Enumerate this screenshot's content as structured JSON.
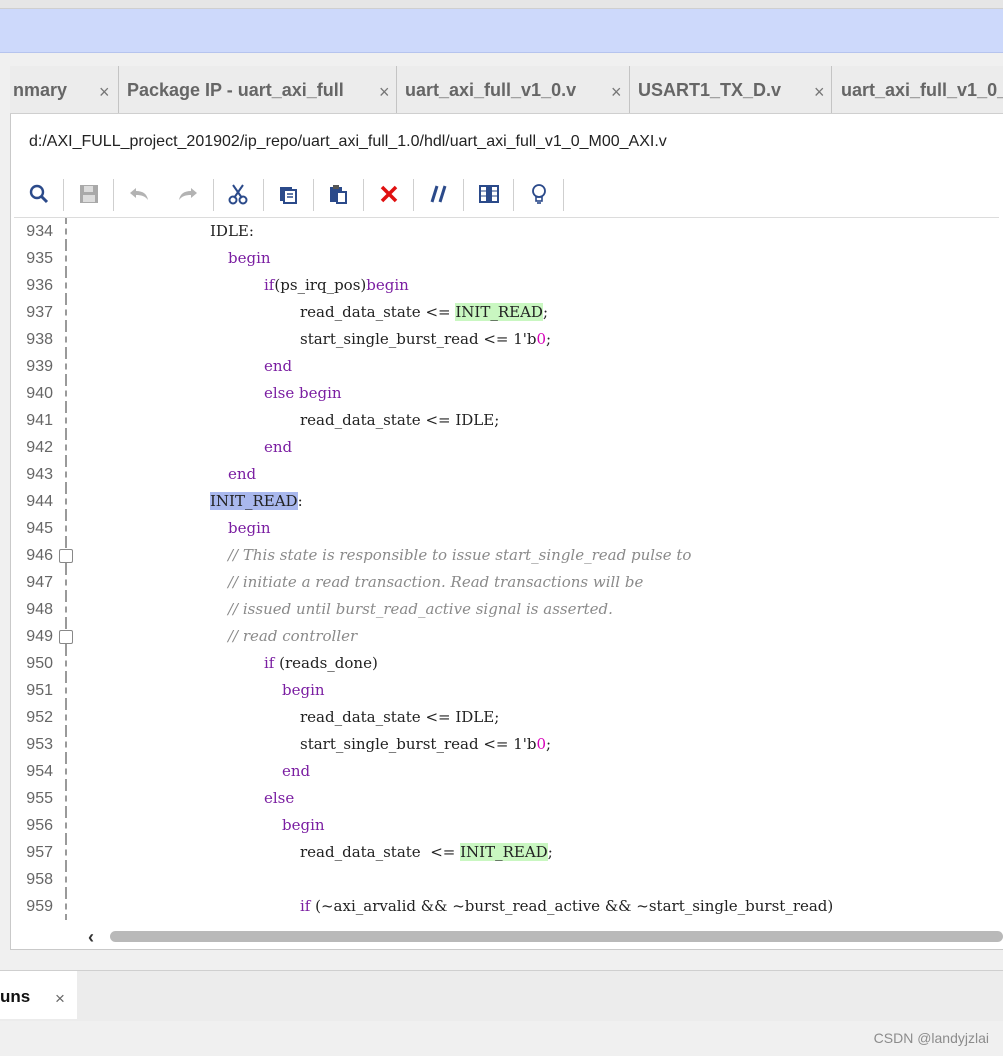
{
  "tabs": [
    {
      "label": "nmary",
      "close": "×"
    },
    {
      "label": "Package IP - uart_axi_full",
      "close": "×"
    },
    {
      "label": "uart_axi_full_v1_0.v",
      "close": "×"
    },
    {
      "label": "USART1_TX_D.v",
      "close": "×"
    },
    {
      "label": "uart_axi_full_v1_0_",
      "close": ""
    }
  ],
  "file_path": "d:/AXI_FULL_project_201902/ip_repo/uart_axi_full_1.0/hdl/uart_axi_full_v1_0_M00_AXI.v",
  "toolbar": {
    "icons": [
      "search-icon",
      "save-icon",
      "undo-icon",
      "redo-icon",
      "cut-icon",
      "copy-icon",
      "paste-icon",
      "delete-icon",
      "comment-icon",
      "column-select-icon",
      "lightbulb-icon"
    ]
  },
  "code_lines": [
    {
      "num": "934",
      "segs": [
        {
          "t": "IDLE:",
          "c": ""
        }
      ]
    },
    {
      "num": "935",
      "segs": [
        {
          "t": "begin",
          "c": "kw"
        }
      ]
    },
    {
      "num": "936",
      "segs": [
        {
          "t": "if",
          "c": "kw"
        },
        {
          "t": "(ps_irq_pos)",
          "c": ""
        },
        {
          "t": "begin",
          "c": "kw"
        }
      ]
    },
    {
      "num": "937",
      "segs": [
        {
          "t": "read_data_state <= ",
          "c": ""
        },
        {
          "t": "INIT_READ",
          "c": "hl-green"
        },
        {
          "t": ";",
          "c": ""
        }
      ]
    },
    {
      "num": "938",
      "segs": [
        {
          "t": "start_single_burst_read <= 1'b",
          "c": ""
        },
        {
          "t": "0",
          "c": "num"
        },
        {
          "t": ";",
          "c": ""
        }
      ]
    },
    {
      "num": "939",
      "segs": [
        {
          "t": "end",
          "c": "kw"
        }
      ]
    },
    {
      "num": "940",
      "segs": [
        {
          "t": "else begin",
          "c": "kw"
        }
      ]
    },
    {
      "num": "941",
      "segs": [
        {
          "t": "read_data_state <= IDLE;",
          "c": ""
        }
      ]
    },
    {
      "num": "942",
      "segs": [
        {
          "t": "end",
          "c": "kw"
        }
      ]
    },
    {
      "num": "943",
      "segs": [
        {
          "t": "end",
          "c": "kw"
        }
      ]
    },
    {
      "num": "944",
      "segs": [
        {
          "t": "INIT_READ",
          "c": "hl-blue"
        },
        {
          "t": ":",
          "c": ""
        }
      ]
    },
    {
      "num": "945",
      "segs": [
        {
          "t": "begin",
          "c": "kw"
        }
      ]
    },
    {
      "num": "946",
      "segs": [
        {
          "t": "// This state is responsible to issue start_single_read pulse to",
          "c": "cm"
        }
      ]
    },
    {
      "num": "947",
      "segs": [
        {
          "t": "// initiate a read transaction. Read transactions will be",
          "c": "cm"
        }
      ]
    },
    {
      "num": "948",
      "segs": [
        {
          "t": "// issued until burst_read_active signal is asserted.",
          "c": "cm"
        }
      ]
    },
    {
      "num": "949",
      "segs": [
        {
          "t": "// read controller",
          "c": "cm"
        }
      ]
    },
    {
      "num": "950",
      "segs": [
        {
          "t": "if",
          "c": "kw"
        },
        {
          "t": " (reads_done)",
          "c": ""
        }
      ]
    },
    {
      "num": "951",
      "segs": [
        {
          "t": "begin",
          "c": "kw"
        }
      ]
    },
    {
      "num": "952",
      "segs": [
        {
          "t": "read_data_state <= IDLE;",
          "c": ""
        }
      ]
    },
    {
      "num": "953",
      "segs": [
        {
          "t": "start_single_burst_read <= 1'b",
          "c": ""
        },
        {
          "t": "0",
          "c": "num"
        },
        {
          "t": ";",
          "c": ""
        }
      ]
    },
    {
      "num": "954",
      "segs": [
        {
          "t": "end",
          "c": "kw"
        }
      ]
    },
    {
      "num": "955",
      "segs": [
        {
          "t": "else",
          "c": "kw"
        }
      ]
    },
    {
      "num": "956",
      "segs": [
        {
          "t": "begin",
          "c": "kw"
        }
      ]
    },
    {
      "num": "957",
      "segs": [
        {
          "t": "read_data_state  <= ",
          "c": ""
        },
        {
          "t": "INIT_READ",
          "c": "hl-green"
        },
        {
          "t": ";",
          "c": ""
        }
      ]
    },
    {
      "num": "958",
      "segs": []
    },
    {
      "num": "959",
      "segs": [
        {
          "t": "if",
          "c": "kw"
        },
        {
          "t": " (~axi_arvalid && ~burst_read_active && ~start_single_burst_read)",
          "c": ""
        }
      ]
    }
  ],
  "bottom_tab": {
    "label": "uns",
    "close": "×"
  },
  "watermark": "CSDN @landyjzlai"
}
